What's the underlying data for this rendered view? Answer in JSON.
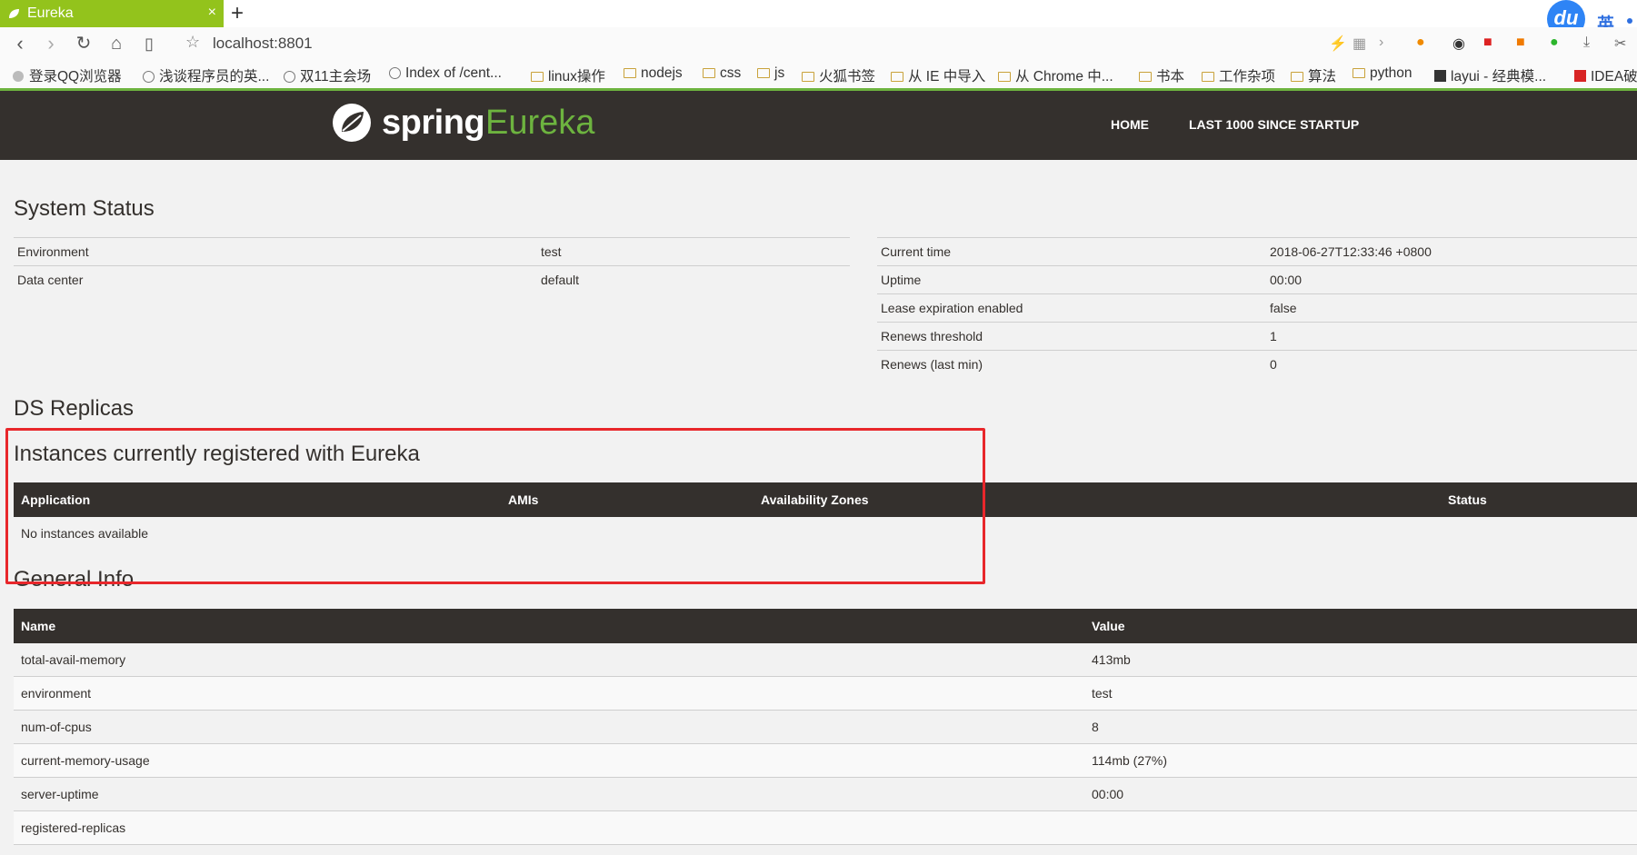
{
  "browser": {
    "tab_title": "Eureka",
    "tab_close": "×",
    "new_tab": "+",
    "url": "localhost:8801",
    "du_label": "du",
    "ime_label": "英",
    "bookmarks": [
      "登录QQ浏览器",
      "浅谈程序员的英...",
      "双11主会场",
      "Index of /cent...",
      "linux操作",
      "nodejs",
      "css",
      "js",
      "火狐书签",
      "从 IE 中导入",
      "从 Chrome 中...",
      "书本",
      "工作杂项",
      "算法",
      "python",
      "layui - 经典模...",
      "IDEA破"
    ]
  },
  "header": {
    "logo_spring": "spring",
    "logo_eureka": "Eureka",
    "nav": [
      "HOME",
      "LAST 1000 SINCE STARTUP"
    ]
  },
  "system_status": {
    "title": "System Status",
    "left": [
      {
        "label": "Environment",
        "value": "test"
      },
      {
        "label": "Data center",
        "value": "default"
      }
    ],
    "right": [
      {
        "label": "Current time",
        "value": "2018-06-27T12:33:46 +0800"
      },
      {
        "label": "Uptime",
        "value": "00:00"
      },
      {
        "label": "Lease expiration enabled",
        "value": "false"
      },
      {
        "label": "Renews threshold",
        "value": "1"
      },
      {
        "label": "Renews (last min)",
        "value": "0"
      }
    ]
  },
  "ds_replicas": {
    "title": "DS Replicas"
  },
  "instances": {
    "title": "Instances currently registered with Eureka",
    "columns": [
      "Application",
      "AMIs",
      "Availability Zones",
      "Status"
    ],
    "empty_text": "No instances available"
  },
  "general_info": {
    "title": "General Info",
    "columns": [
      "Name",
      "Value"
    ],
    "rows": [
      {
        "name": "total-avail-memory",
        "value": "413mb"
      },
      {
        "name": "environment",
        "value": "test"
      },
      {
        "name": "num-of-cpus",
        "value": "8"
      },
      {
        "name": "current-memory-usage",
        "value": "114mb (27%)"
      },
      {
        "name": "server-uptime",
        "value": "00:00"
      },
      {
        "name": "registered-replicas",
        "value": ""
      }
    ]
  },
  "colors": {
    "header_bg": "#34302d",
    "spring_green": "#6db33f",
    "tab_green": "#93c31c",
    "annotation_red": "#e8272b"
  }
}
